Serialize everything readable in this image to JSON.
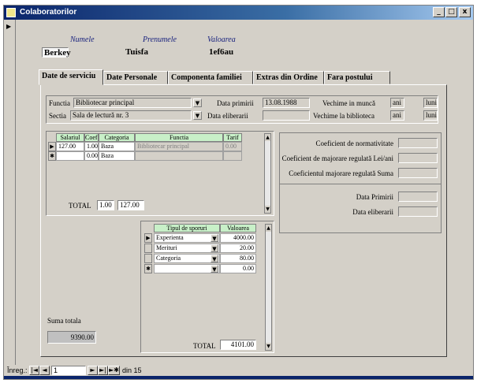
{
  "window": {
    "title": "Colaboratorilor",
    "btn_min": "_",
    "btn_max": "□",
    "btn_close": "x"
  },
  "header": {
    "col1": "Numele",
    "col2": "Prenumele",
    "col3": "Valoarea",
    "val1": "Berkey",
    "val2": "Tuisfa",
    "val3": "1ef6au"
  },
  "tabs": [
    "Date de serviciu",
    "Date Personale",
    "Componenta familiei",
    "Extras din Ordine",
    "Fara postului"
  ],
  "fields": {
    "functia_label": "Functia",
    "functia_value": "Bibliotecar principal",
    "sectia_label": "Sectia",
    "sectia_value": "Sala de lectură nr. 3",
    "data_primirii_label": "Data primirii",
    "data_primirii_value": "13.08.1988",
    "data_eliberarii_label": "Data eliberarii",
    "data_eliberarii_value": "",
    "vechime_munca_label": "Vechime in muncă",
    "vechime_biblioteca_label": "Vechime la biblioteca",
    "ani": "ani",
    "luni": "luni"
  },
  "salary_table": {
    "headers": [
      "Salariul",
      "Coef.",
      "Categoria",
      "Functia",
      "Tarif"
    ],
    "rows": [
      {
        "marker": "▶",
        "salariu": "127.00",
        "coef": "1.00",
        "categorie": "Baza",
        "functia": "Bibliotecar principal",
        "tarif": "0.00"
      },
      {
        "marker": "✱",
        "salariu": "",
        "coef": "0.00",
        "categorie": "Baza",
        "functia": "",
        "tarif": ""
      }
    ],
    "total_label": "TOTAL",
    "total_coef": "1.00",
    "total_value": "127.00"
  },
  "right_panel": {
    "labels": [
      "Coeficient de normativitate",
      "Coeficient de majorare regulată Lei/ani",
      "Coeficientul majorare regulată Suma",
      "Data Primirii",
      "Data eliberarii"
    ]
  },
  "sporuri_table": {
    "headers": [
      "Tipul de sporuri",
      "Valoarea"
    ],
    "rows": [
      {
        "marker": "▶",
        "tip": "Experienta",
        "valoare": "4000.00"
      },
      {
        "marker": "",
        "tip": "Merituri",
        "valoare": "20.00"
      },
      {
        "marker": "",
        "tip": "Categoria",
        "valoare": "80.00"
      },
      {
        "marker": "✱",
        "tip": "",
        "valoare": "0.00"
      }
    ],
    "total_label": "TOTAL",
    "total_value": "4101.00"
  },
  "suma_totala": {
    "label": "Suma totala",
    "value": "9390.00"
  },
  "navigation": {
    "label": "Înreg.:",
    "current": "1",
    "of_text": "din 15",
    "first": "|◄",
    "prev": "◄",
    "next": "►",
    "last": "►|",
    "new": "►✱"
  }
}
